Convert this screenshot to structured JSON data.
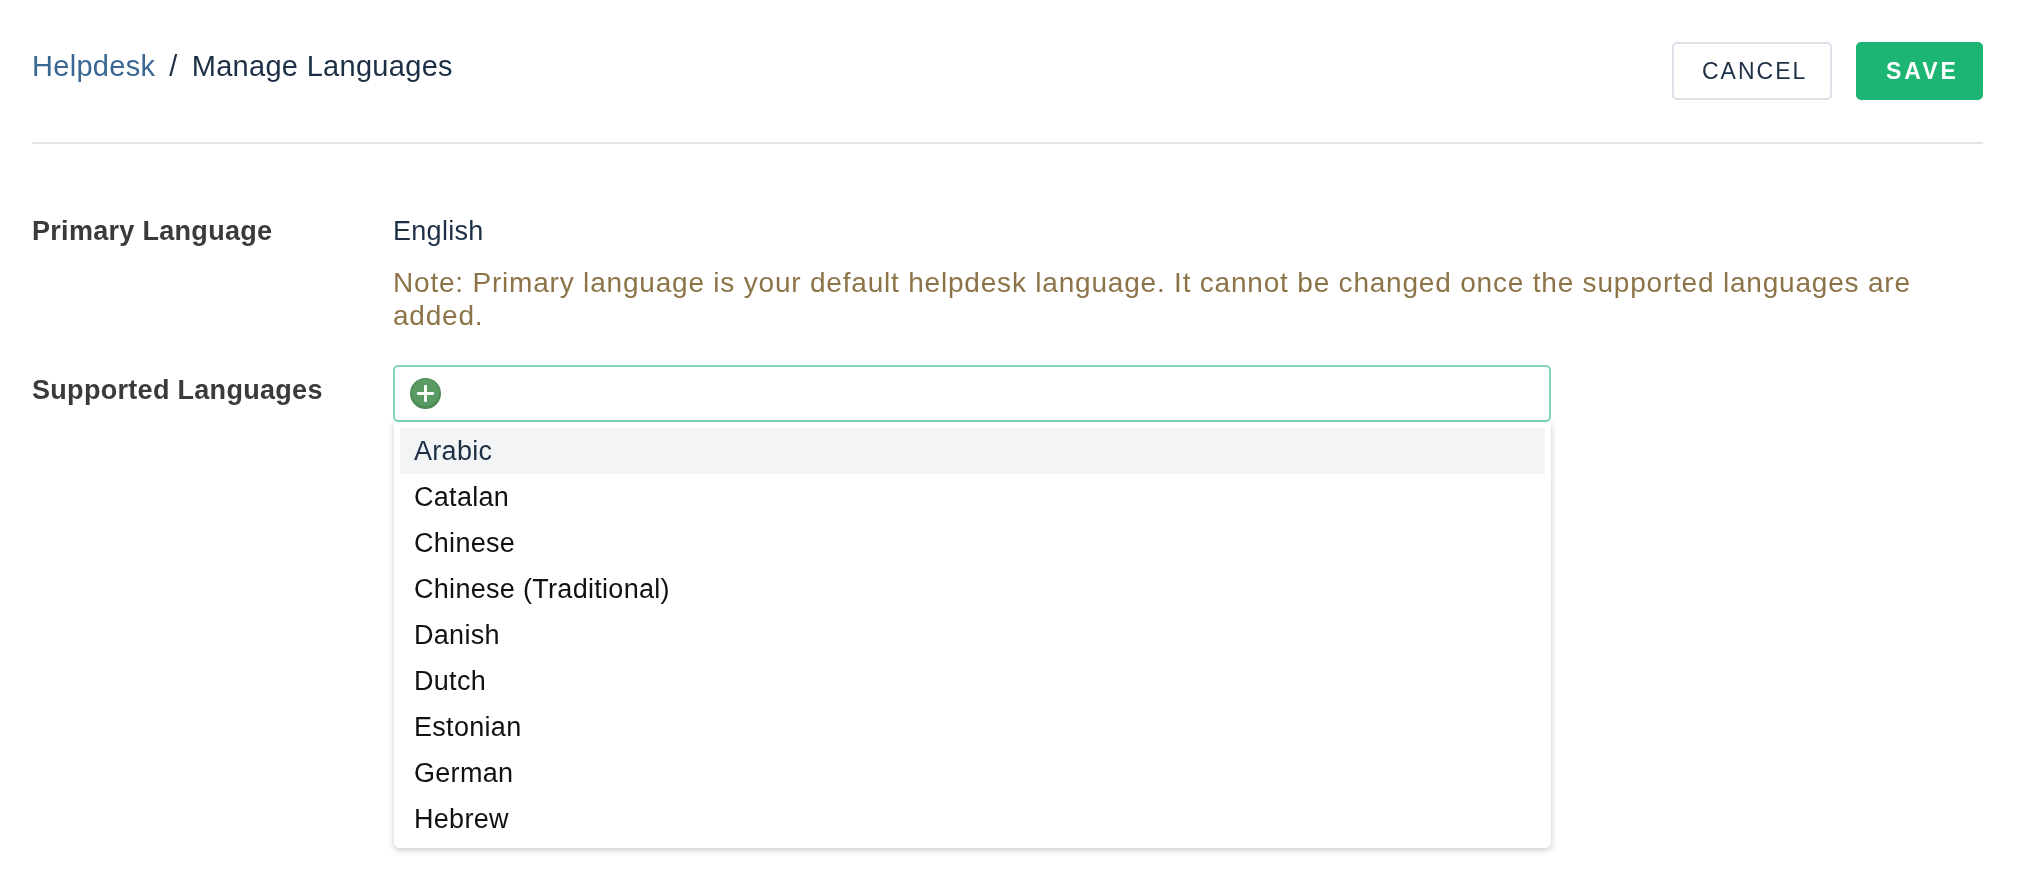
{
  "breadcrumb": {
    "items": [
      {
        "label": "Helpdesk",
        "kind": "link"
      },
      {
        "label": "Manage Languages",
        "kind": "current"
      }
    ],
    "separator": "/"
  },
  "actions": [
    {
      "label": "CANCEL",
      "kind": "secondary"
    },
    {
      "label": "SAVE",
      "kind": "primary"
    }
  ],
  "primary_language": {
    "label": "Primary Language",
    "value": "English",
    "note": "Note: Primary language is your default helpdesk language. It cannot be changed once the supported languages are added."
  },
  "supported_languages": {
    "label": "Supported Languages",
    "options": [
      {
        "label": "Arabic",
        "selected": true
      },
      {
        "label": "Catalan",
        "selected": false
      },
      {
        "label": "Chinese",
        "selected": false
      },
      {
        "label": "Chinese (Traditional)",
        "selected": false
      },
      {
        "label": "Danish",
        "selected": false
      },
      {
        "label": "Dutch",
        "selected": false
      },
      {
        "label": "Estonian",
        "selected": false
      },
      {
        "label": "German",
        "selected": false
      },
      {
        "label": "Hebrew",
        "selected": false
      }
    ]
  }
}
